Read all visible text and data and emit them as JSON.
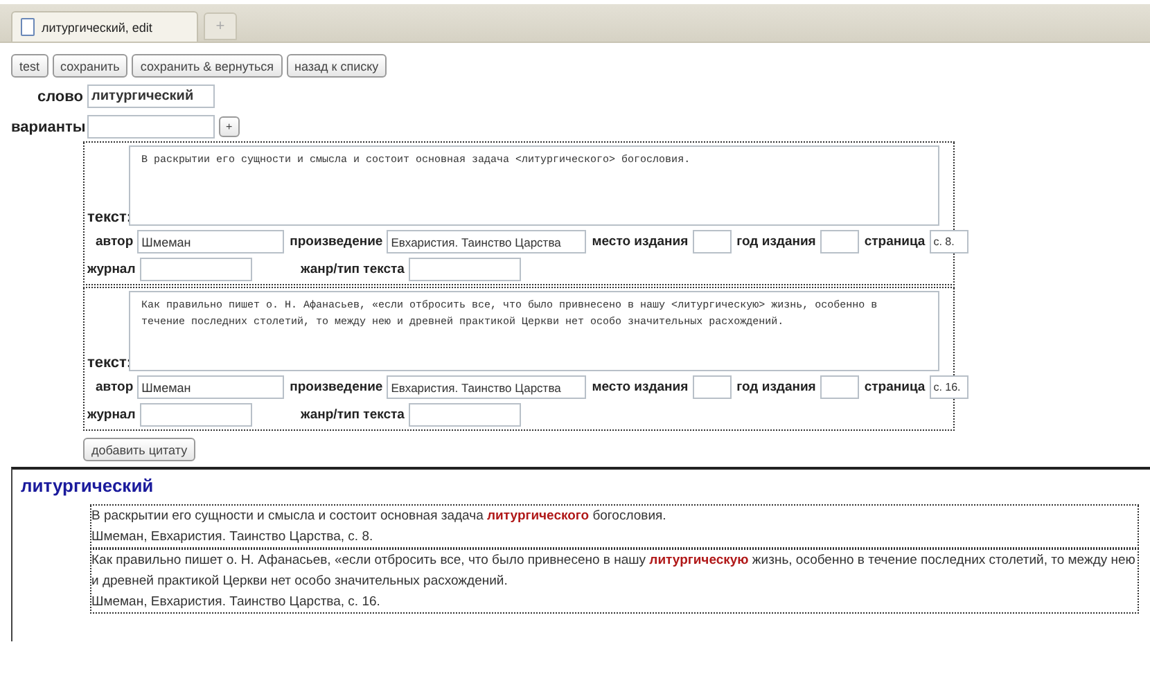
{
  "tab": {
    "title": "литургический, edit",
    "new_tab": "+"
  },
  "toolbar": [
    "test",
    "сохранить",
    "сохранить & вернуться",
    "назад к списку"
  ],
  "word_field": {
    "label": "слово",
    "value": "литургический"
  },
  "variants_field": {
    "label": "варианты",
    "button": "+"
  },
  "citations": [
    {
      "text_label": "текст:",
      "text": "В раскрытии его сущности и смысла и состоит основная задача <литургического> богословия.",
      "row1": [
        {
          "label": "автор",
          "value": "Шмеман",
          "kind": "wide"
        },
        {
          "label": "произведение",
          "value": "Евхаристия. Таинство Царства",
          "kind": "wide"
        },
        {
          "label": "место издания",
          "kind": "short"
        },
        {
          "label": "год издания",
          "kind": "short"
        },
        {
          "label": "страница",
          "value": "с. 8.",
          "kind": "short"
        }
      ],
      "row2": [
        {
          "label": "журнал"
        },
        {
          "label": "жанр/тип текста"
        }
      ]
    },
    {
      "text_label": "текст:",
      "text": "Как правильно пишет о. Н. Афанасьев, «если отбросить все, что было привнесено в нашу <литургическую> жизнь, особенно в течение последних столетий, то между нею и древней практикой Церкви нет особо значительных расхождений.",
      "row1": [
        {
          "label": "автор",
          "value": "Шмеман",
          "kind": "wide"
        },
        {
          "label": "произведение",
          "value": "Евхаристия. Таинство Царства",
          "kind": "wide"
        },
        {
          "label": "место издания",
          "kind": "short"
        },
        {
          "label": "год издания",
          "kind": "short"
        },
        {
          "label": "страница",
          "value": "с. 16.",
          "kind": "short"
        }
      ],
      "row2": [
        {
          "label": "журнал"
        },
        {
          "label": "жанр/тип текста"
        }
      ]
    }
  ],
  "add_button": "добавить цитату",
  "preview": {
    "heading": "литургический",
    "entries": [
      {
        "quote": "В раскрытии его сущности и смысла и состоит основная задача **литургического** богословия.",
        "source": "Шмеман, Евхаристия. Таинство Царства, с. 8."
      },
      {
        "quote": "Как правильно пишет о. Н. Афанасьев, «если отбросить все, что было привнесено в нашу **литургическую** жизнь, особенно в течение последних столетий, то между нею и древней практикой Церкви нет особо значительных расхождений.",
        "source": "Шмеман, Евхаристия. Таинство Царства, с. 16."
      }
    ]
  }
}
